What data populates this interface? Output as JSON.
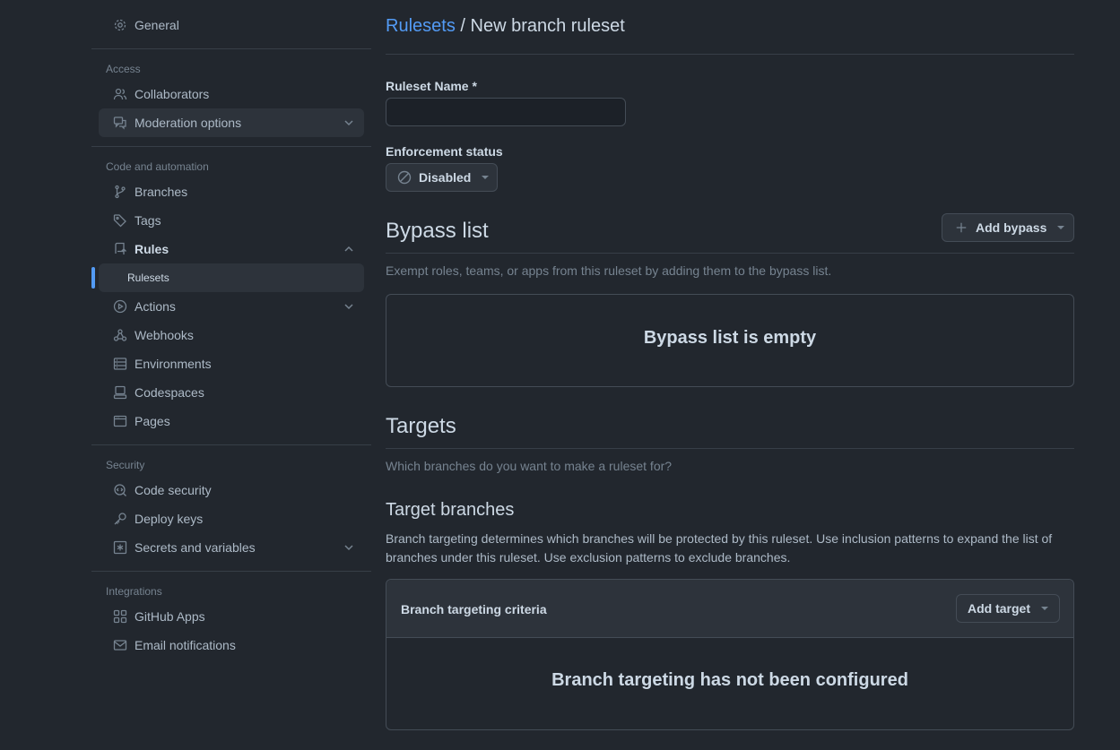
{
  "sidebar": {
    "general": "General",
    "access_label": "Access",
    "collaborators": "Collaborators",
    "moderation": "Moderation options",
    "code_label": "Code and automation",
    "branches": "Branches",
    "tags": "Tags",
    "rules": "Rules",
    "rulesets": "Rulesets",
    "actions": "Actions",
    "webhooks": "Webhooks",
    "environments": "Environments",
    "codespaces": "Codespaces",
    "pages": "Pages",
    "security_label": "Security",
    "code_security": "Code security",
    "deploy_keys": "Deploy keys",
    "secrets": "Secrets and variables",
    "integrations_label": "Integrations",
    "github_apps": "GitHub Apps",
    "email_notifications": "Email notifications"
  },
  "main": {
    "breadcrumb_link": "Rulesets",
    "breadcrumb_sep": "/",
    "breadcrumb_current": "New branch ruleset",
    "name_label": "Ruleset Name *",
    "name_value": "",
    "enforcement_label": "Enforcement status",
    "enforcement_value": "Disabled",
    "bypass_title": "Bypass list",
    "add_bypass": "Add bypass",
    "bypass_desc": "Exempt roles, teams, or apps from this ruleset by adding them to the bypass list.",
    "bypass_empty": "Bypass list is empty",
    "targets_title": "Targets",
    "targets_desc": "Which branches do you want to make a ruleset for?",
    "target_branches_title": "Target branches",
    "target_branches_desc": "Branch targeting determines which branches will be protected by this ruleset. Use inclusion patterns to expand the list of branches under this ruleset. Use exclusion patterns to exclude branches.",
    "criteria_label": "Branch targeting criteria",
    "add_target": "Add target",
    "targeting_empty": "Branch targeting has not been configured"
  },
  "colors": {
    "background": "#22272e",
    "link": "#539bf5",
    "active_indicator": "#539bf5"
  }
}
